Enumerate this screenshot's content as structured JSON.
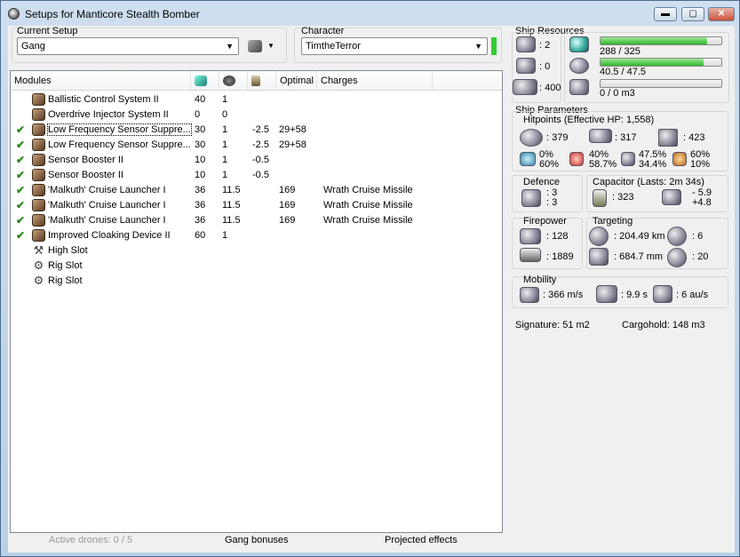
{
  "window": {
    "title": "Setups for Manticore Stealth Bomber",
    "minimize": "▬",
    "maximize": "▢",
    "close": "✕"
  },
  "setup": {
    "label": "Current Setup",
    "value": "Gang"
  },
  "character": {
    "label": "Character",
    "value": "TimtheTerror"
  },
  "modules": {
    "headers": [
      "Modules",
      "",
      "",
      "",
      "Optimal",
      "Charges"
    ],
    "header_icons": [
      "cpu-icon",
      "powergrid-icon",
      "capacitor-use-icon"
    ],
    "rows": [
      {
        "check": "",
        "name": "Ballistic Control System II",
        "cpu": "40",
        "pg": "1",
        "cap": "",
        "optimal": "",
        "charges": ""
      },
      {
        "check": "",
        "name": "Overdrive Injector System II",
        "cpu": "0",
        "pg": "0",
        "cap": "",
        "optimal": "",
        "charges": ""
      },
      {
        "check": "✔",
        "name": "Low Frequency Sensor Suppre...",
        "cpu": "30",
        "pg": "1",
        "cap": "-2.5",
        "optimal": "29+58",
        "charges": ""
      },
      {
        "check": "✔",
        "name": "Low Frequency Sensor Suppre...",
        "cpu": "30",
        "pg": "1",
        "cap": "-2.5",
        "optimal": "29+58",
        "charges": ""
      },
      {
        "check": "✔",
        "name": "Sensor Booster II",
        "cpu": "10",
        "pg": "1",
        "cap": "-0.5",
        "optimal": "",
        "charges": ""
      },
      {
        "check": "✔",
        "name": "Sensor Booster II",
        "cpu": "10",
        "pg": "1",
        "cap": "-0.5",
        "optimal": "",
        "charges": ""
      },
      {
        "check": "✔",
        "name": "'Malkuth' Cruise Launcher I",
        "cpu": "36",
        "pg": "11.5",
        "cap": "",
        "optimal": "169",
        "charges": "Wrath Cruise Missile"
      },
      {
        "check": "✔",
        "name": "'Malkuth' Cruise Launcher I",
        "cpu": "36",
        "pg": "11.5",
        "cap": "",
        "optimal": "169",
        "charges": "Wrath Cruise Missile"
      },
      {
        "check": "✔",
        "name": "'Malkuth' Cruise Launcher I",
        "cpu": "36",
        "pg": "11.5",
        "cap": "",
        "optimal": "169",
        "charges": "Wrath Cruise Missile"
      },
      {
        "check": "✔",
        "name": "Improved Cloaking Device II",
        "cpu": "60",
        "pg": "1",
        "cap": "",
        "optimal": "",
        "charges": ""
      },
      {
        "check": "",
        "name": "High Slot",
        "cpu": "",
        "pg": "",
        "cap": "",
        "optimal": "",
        "charges": ""
      },
      {
        "check": "",
        "name": "Rig Slot",
        "cpu": "",
        "pg": "",
        "cap": "",
        "optimal": "",
        "charges": ""
      },
      {
        "check": "",
        "name": "Rig Slot",
        "cpu": "",
        "pg": "",
        "cap": "",
        "optimal": "",
        "charges": ""
      }
    ]
  },
  "status": {
    "drones": "Active drones: 0 / 5",
    "gang": "Gang bonuses",
    "projected": "Projected effects"
  },
  "resources": {
    "title": "Ship Resources",
    "turrets": ": 2",
    "launchers": ": 0",
    "drone_bay": ": 400",
    "cpu": "288 / 325",
    "cpu_frac": 0.886,
    "powergrid": "40.5 / 47.5",
    "pg_frac": 0.853,
    "drone_bw": "0 / 0 m3",
    "drone_frac": 0
  },
  "params": {
    "title": "Ship Parameters",
    "hitpoints_title": "Hitpoints (Effective HP: 1,558)",
    "shield_hp": ": 379",
    "armor_hp": ": 317",
    "structure_hp": ": 423",
    "res_em": [
      "0%",
      "60%"
    ],
    "res_therm": [
      "40%",
      "58.7%"
    ],
    "res_kin": [
      "47.5%",
      "34.4%"
    ],
    "res_exp": [
      "60%",
      "10%"
    ],
    "defence_title": "Defence",
    "def_values": [
      ": 3",
      ": 3"
    ],
    "capacitor_title": "Capacitor (Lasts: 2m 34s)",
    "cap_amount": ": 323",
    "cap_delta": [
      "- 5.9",
      "+4.8"
    ],
    "firepower_title": "Firepower",
    "dps": ": 128",
    "volley": ": 1889",
    "targeting_title": "Targeting",
    "target_range": ": 204.49 km",
    "max_targets": ": 6",
    "scan_res": ": 684.7 mm",
    "sensor_strength": ": 20",
    "mobility_title": "Mobility",
    "velocity": ": 366 m/s",
    "align": ": 9.9 s",
    "warp": ": 6 au/s",
    "signature": "Signature: 51 m2",
    "cargo": "Cargohold: 148 m3"
  }
}
